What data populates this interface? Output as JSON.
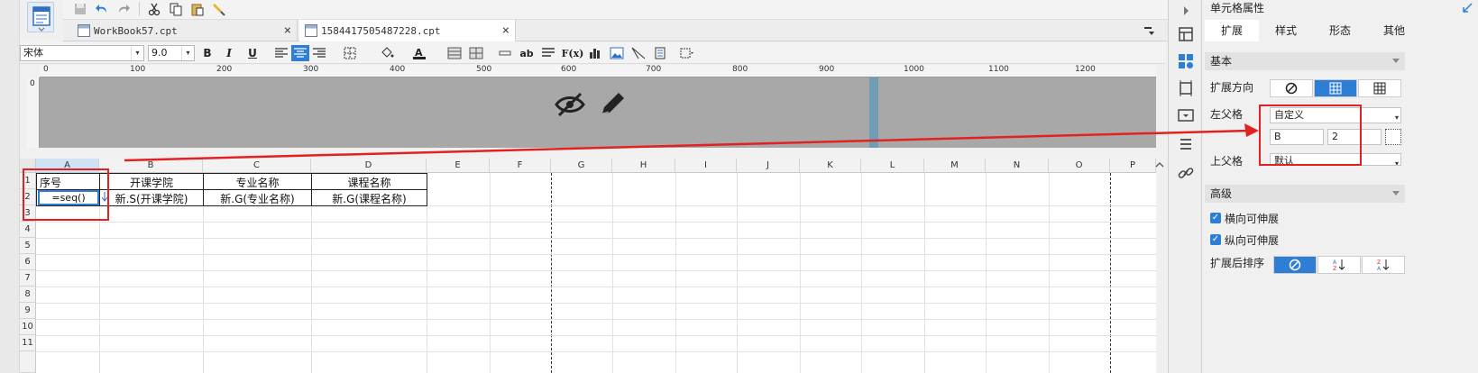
{
  "tabs": [
    {
      "label": "WorkBook57.cpt",
      "close": "×"
    },
    {
      "label": "1584417505487228.cpt",
      "close": "×"
    }
  ],
  "format": {
    "font": "宋体",
    "size": "9.0",
    "bold": "B",
    "italic": "I",
    "underline": "U",
    "text_tool": "ab",
    "formula": "F(x)",
    "arrow": "▾"
  },
  "ruler": {
    "ticks": [
      "0",
      "100",
      "200",
      "300",
      "400",
      "500",
      "600",
      "700",
      "800",
      "900",
      "1000",
      "1100",
      "1200"
    ],
    "v_tick": "0"
  },
  "grid": {
    "columns": [
      "A",
      "B",
      "C",
      "D",
      "E",
      "F",
      "G",
      "H",
      "I",
      "J",
      "K",
      "L",
      "M",
      "N",
      "O",
      "P"
    ],
    "rows": [
      "1",
      "2",
      "3",
      "4",
      "5",
      "6",
      "7",
      "8",
      "9",
      "10",
      "11"
    ],
    "row1": [
      "序号",
      "开课学院",
      "专业名称",
      "课程名称"
    ],
    "row2": [
      "=seq()",
      "新.S(开课学院)",
      "新.G(专业名称)",
      "新.G(课程名称)"
    ]
  },
  "panel": {
    "title": "单元格属性",
    "tabs": [
      "扩展",
      "样式",
      "形态",
      "其他"
    ],
    "basic": "基本",
    "expand_dir": "扩展方向",
    "left_parent": "左父格",
    "left_parent_value": "自定义",
    "left_col": "B",
    "left_row": "2",
    "up_parent": "上父格",
    "up_parent_value": "默认",
    "advanced": "高级",
    "h_expand": "横向可伸展",
    "v_expand": "纵向可伸展",
    "sort_after": "扩展后排序",
    "check": "✓"
  },
  "colors": {
    "accent": "#2e7ed6",
    "annotation": "#e02222",
    "header_area": "#a8a8a8"
  }
}
